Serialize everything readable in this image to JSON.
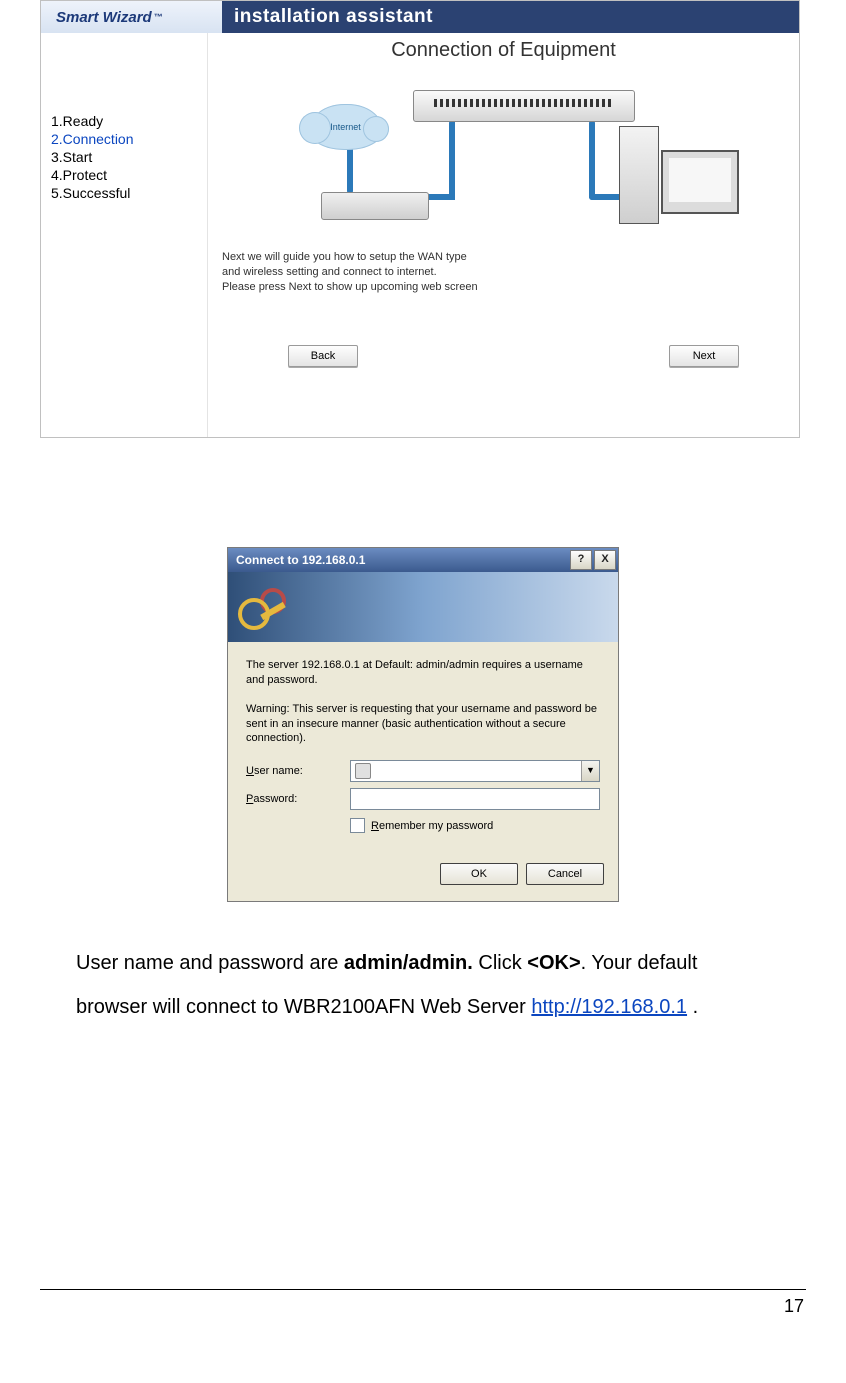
{
  "wizard": {
    "brand": "Smart Wizard",
    "brand_tm": "™",
    "title": "installation assistant",
    "steps": [
      "1.Ready",
      "2.Connection",
      "3.Start",
      "4.Protect",
      "5.Successful"
    ],
    "active_step_index": 1,
    "diagram_title": "Connection of Equipment",
    "cloud_label": "Internet",
    "instructions_line1": "Next we will guide you how to setup the WAN type",
    "instructions_line2": "and wireless setting and connect to internet.",
    "instructions_line3": "Please press Next to show up upcoming web screen",
    "back_label": "Back",
    "next_label": "Next"
  },
  "dialog": {
    "title": "Connect to 192.168.0.1",
    "help_glyph": "?",
    "close_glyph": "X",
    "msg1": "The server 192.168.0.1 at Default: admin/admin requires a username and password.",
    "msg2": "Warning: This server is requesting that your username and password be sent in an insecure manner (basic authentication without a secure connection).",
    "username_label": "User name:",
    "username_u": "U",
    "password_label": "Password:",
    "password_u": "P",
    "remember_label": "Remember my password",
    "remember_u": "R",
    "username_value": "",
    "password_value": "",
    "combo_arrow": "▼",
    "ok_label": "OK",
    "cancel_label": "Cancel"
  },
  "doc": {
    "line1_pre": "User name and password are ",
    "line1_bold1": "admin/admin.",
    "line1_mid": " Click ",
    "line1_bold2": "<OK>",
    "line1_post": ". Your default",
    "line2_pre": "browser will connect to WBR2100AFN Web Server ",
    "line2_link": "http://192.168.0.1",
    "line2_post": " .",
    "page_number": "17"
  },
  "colors": {
    "header_bg": "#2b4272",
    "step_active": "#0b46c0",
    "wire": "#2b79b9",
    "dlg_bg": "#ece9d8"
  }
}
